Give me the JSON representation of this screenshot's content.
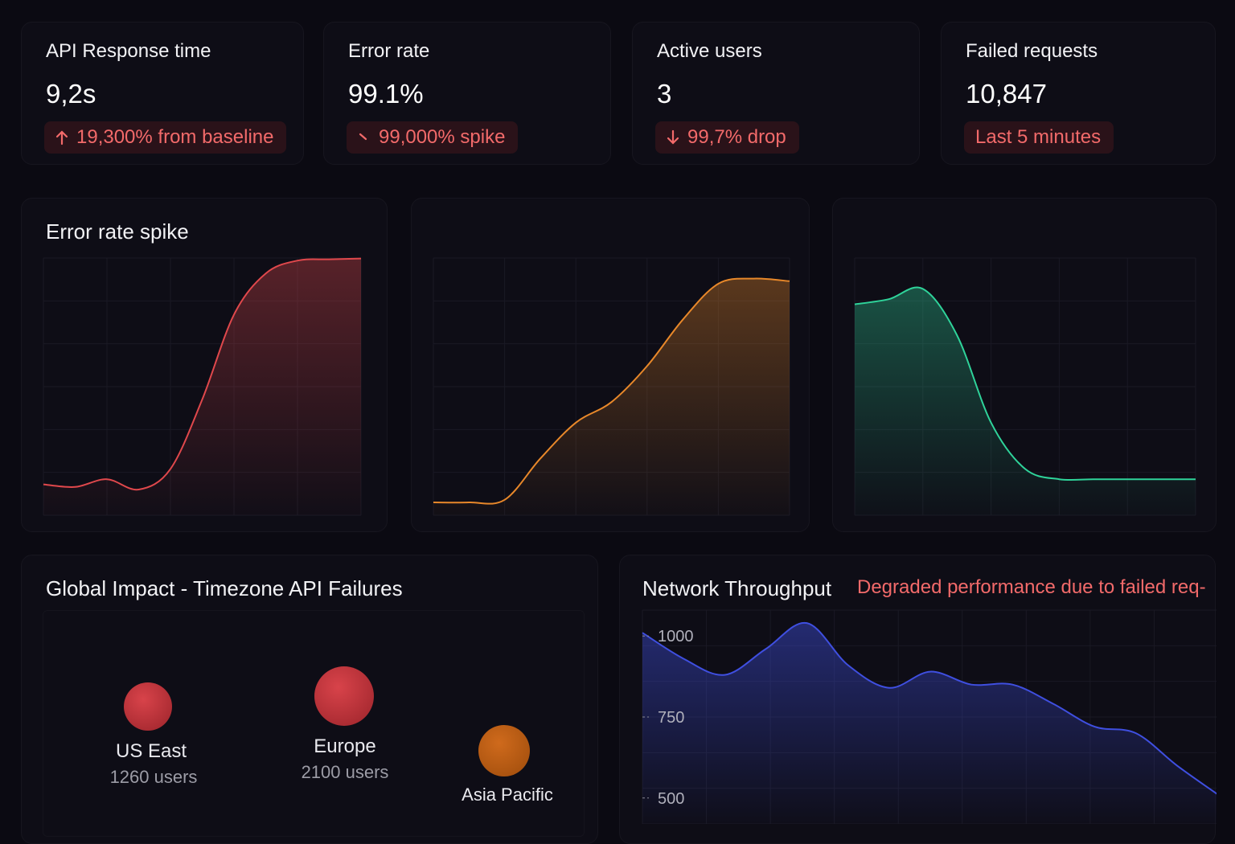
{
  "kpis": [
    {
      "title": "API Response time",
      "value": "9,2s",
      "badge": "19,300% from baseline",
      "icon": "arrow-up-icon"
    },
    {
      "title": "Error rate",
      "value": "99.1%",
      "badge": "99,000% spike",
      "icon": "spike-icon"
    },
    {
      "title": "Active users",
      "value": "3",
      "badge": "99,7% drop",
      "icon": "arrow-down-icon"
    },
    {
      "title": "Failed requests",
      "value": "10,847",
      "badge": "Last 5 minutes",
      "icon": ""
    }
  ],
  "charts": {
    "error_spike_title": "Error rate spike"
  },
  "impact": {
    "title": "Global Impact - Timezone API Failures",
    "regions": [
      {
        "name": "US East",
        "users": "1260 users",
        "color": "#c8333a"
      },
      {
        "name": "Europe",
        "users": "2100 users",
        "color": "#c8333a"
      },
      {
        "name": "Asia Pacific",
        "users": "",
        "color": "#c75f1a"
      }
    ]
  },
  "network": {
    "title": "Network Throughput",
    "alert": "Degraded performance due to failed req-"
  },
  "colors": {
    "background": "#0b0a12",
    "red": "#e0484c",
    "orange": "#e8882a",
    "green": "#2fd39a",
    "blue": "#3f4fe0",
    "badge_text": "#f26a6a"
  },
  "chart_data": [
    {
      "type": "area",
      "title": "Error rate spike",
      "x": [
        0,
        1,
        2,
        3,
        4,
        5,
        6,
        7,
        8,
        9,
        10
      ],
      "values": [
        12,
        11,
        14,
        10,
        18,
        45,
        78,
        94,
        99,
        99.5,
        99.8
      ],
      "ylim": [
        0,
        100
      ],
      "grid": true
    },
    {
      "type": "area",
      "title": "",
      "x": [
        0,
        1,
        2,
        3,
        4,
        5,
        6,
        7,
        8,
        9,
        10
      ],
      "values": [
        5,
        5,
        6,
        22,
        36,
        44,
        58,
        76,
        90,
        92,
        91
      ],
      "ylim": [
        0,
        100
      ],
      "grid": true
    },
    {
      "type": "area",
      "title": "",
      "x": [
        0,
        1,
        2,
        3,
        4,
        5,
        6,
        7,
        8,
        9,
        10
      ],
      "values": [
        82,
        84,
        88,
        70,
        36,
        18,
        14,
        14,
        14,
        14,
        14
      ],
      "ylim": [
        0,
        100
      ],
      "grid": true
    },
    {
      "type": "area",
      "title": "Network Throughput",
      "x": [
        0,
        1,
        2,
        3,
        4,
        5,
        6,
        7,
        8,
        9,
        10,
        11,
        12,
        13,
        14
      ],
      "values": [
        1010,
        930,
        880,
        960,
        1040,
        910,
        840,
        890,
        850,
        850,
        790,
        720,
        700,
        600,
        510
      ],
      "yticks": [
        500,
        750,
        1000
      ],
      "ylim": [
        420,
        1080
      ],
      "grid": true
    }
  ]
}
